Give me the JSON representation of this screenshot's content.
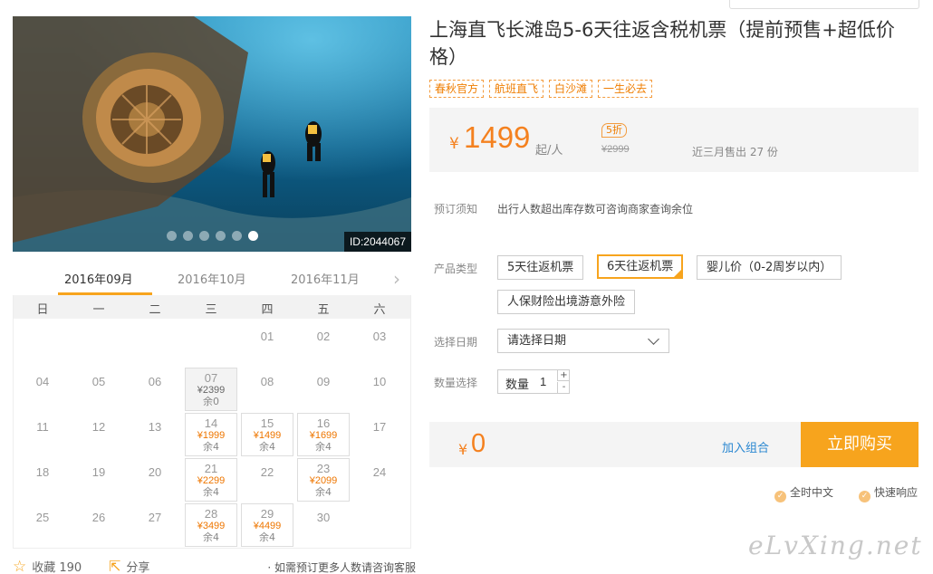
{
  "product": {
    "title": "上海直飞长滩岛5-6天往返含税机票（提前预售+超低价格）",
    "tags": [
      "春秋官方",
      "航班直飞",
      "白沙滩",
      "一生必去"
    ],
    "image_id": "ID:2044067",
    "gallery_count": 6,
    "gallery_active": 6
  },
  "price": {
    "currency": "¥",
    "value": "1499",
    "unit": "起/人",
    "discount": "5折",
    "original": "¥2999",
    "sold": "近三月售出 27 份"
  },
  "booking": {
    "notice_label": "预订须知",
    "notice_text": "出行人数超出库存数可咨询商家查询余位",
    "type_label": "产品类型",
    "types": [
      "5天往返机票",
      "6天往返机票",
      "婴儿价（0-2周岁以内）",
      "人保财险出境游意外险"
    ],
    "selected_type": 1,
    "date_label": "选择日期",
    "date_placeholder": "请选择日期",
    "qty_label": "数量选择",
    "qty_inner_label": "数量",
    "qty_value": "1",
    "qty_plus": "+",
    "qty_minus": "-"
  },
  "buy": {
    "currency": "¥",
    "total": "0",
    "add_combo": "加入组合",
    "buy_now": "立即购买"
  },
  "badges": [
    "全时中文",
    "快速响应"
  ],
  "calendar": {
    "months": [
      "2016年09月",
      "2016年10月",
      "2016年11月"
    ],
    "active_month": 0,
    "weekdays": [
      "日",
      "一",
      "二",
      "三",
      "四",
      "五",
      "六"
    ],
    "days": [
      {
        "d": "01"
      },
      {
        "d": "02"
      },
      {
        "d": "03"
      },
      {
        "d": "04"
      },
      {
        "d": "05"
      },
      {
        "d": "06"
      },
      {
        "d": "07",
        "price": "¥2399",
        "stock": "余0",
        "soldout": true
      },
      {
        "d": "08"
      },
      {
        "d": "09"
      },
      {
        "d": "10"
      },
      {
        "d": "11"
      },
      {
        "d": "12"
      },
      {
        "d": "13"
      },
      {
        "d": "14",
        "price": "¥1999",
        "stock": "余4"
      },
      {
        "d": "15",
        "price": "¥1499",
        "stock": "余4"
      },
      {
        "d": "16",
        "price": "¥1699",
        "stock": "余4"
      },
      {
        "d": "17"
      },
      {
        "d": "18"
      },
      {
        "d": "19"
      },
      {
        "d": "20"
      },
      {
        "d": "21",
        "price": "¥2299",
        "stock": "余4"
      },
      {
        "d": "22"
      },
      {
        "d": "23",
        "price": "¥2099",
        "stock": "余4"
      },
      {
        "d": "24"
      },
      {
        "d": "25"
      },
      {
        "d": "26"
      },
      {
        "d": "27"
      },
      {
        "d": "28",
        "price": "¥3499",
        "stock": "余4"
      },
      {
        "d": "29",
        "price": "¥4499",
        "stock": "余4"
      },
      {
        "d": "30"
      }
    ]
  },
  "actions": {
    "favorite": "收藏 190",
    "share": "分享",
    "consult_note": "· 如需预订更多人数请咨询客服"
  },
  "watermark": "eLvXing.net",
  "colors": {
    "accent": "#f7a41d",
    "price": "#f4811f",
    "link": "#2a87d1"
  }
}
